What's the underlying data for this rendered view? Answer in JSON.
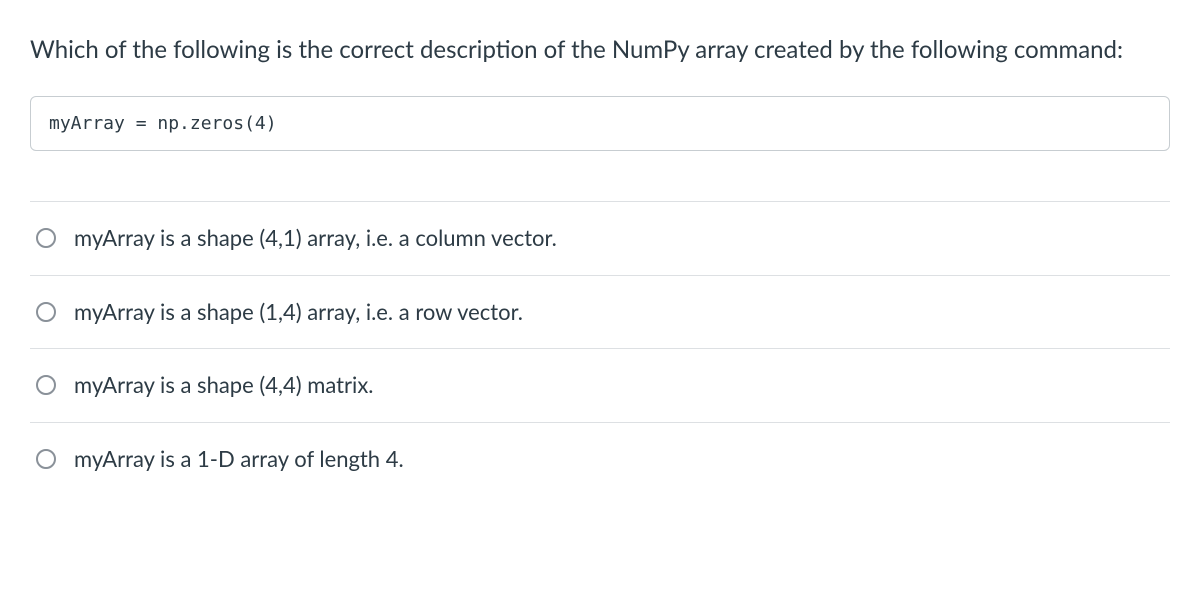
{
  "question": {
    "text": "Which of the following is the correct description of the NumPy array created by the following command:",
    "code": "myArray = np.zeros(4)"
  },
  "options": [
    {
      "label": "myArray is a shape (4,1) array, i.e. a column vector."
    },
    {
      "label": "myArray is a shape (1,4) array, i.e. a row vector."
    },
    {
      "label": "myArray is a shape (4,4) matrix."
    },
    {
      "label": "myArray is a 1-D array of length 4."
    }
  ]
}
